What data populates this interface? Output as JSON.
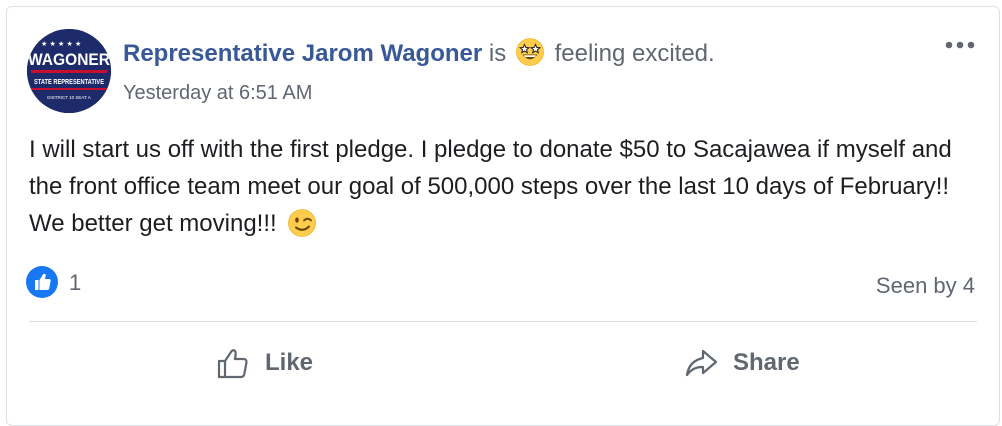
{
  "post": {
    "avatar": {
      "name_text": "WAGONER",
      "title_text": "STATE REPRESENTATIVE",
      "district_text": "DISTRICT 10 SEAT A"
    },
    "author": "Representative Jarom Wagoner",
    "is_text": "is",
    "feeling_text": "feeling excited.",
    "feeling_icon": "star-struck-emoji-icon",
    "timestamp": "Yesterday at 6:51 AM",
    "body": "I will start us off with the first pledge. I pledge to donate $50 to Sacajawea if myself and the front office team meet our goal of 500,000 steps over the last 10 days of February!! We better get moving!!!",
    "body_emoji": "winking-face-emoji-icon"
  },
  "stats": {
    "like_count": "1",
    "seen_by": "Seen by 4"
  },
  "actions": {
    "like_label": "Like",
    "share_label": "Share"
  },
  "colors": {
    "author_link": "#385898",
    "secondary_text": "#606770",
    "like_blue": "#1877f2",
    "avatar_navy": "#1e2b6b"
  }
}
